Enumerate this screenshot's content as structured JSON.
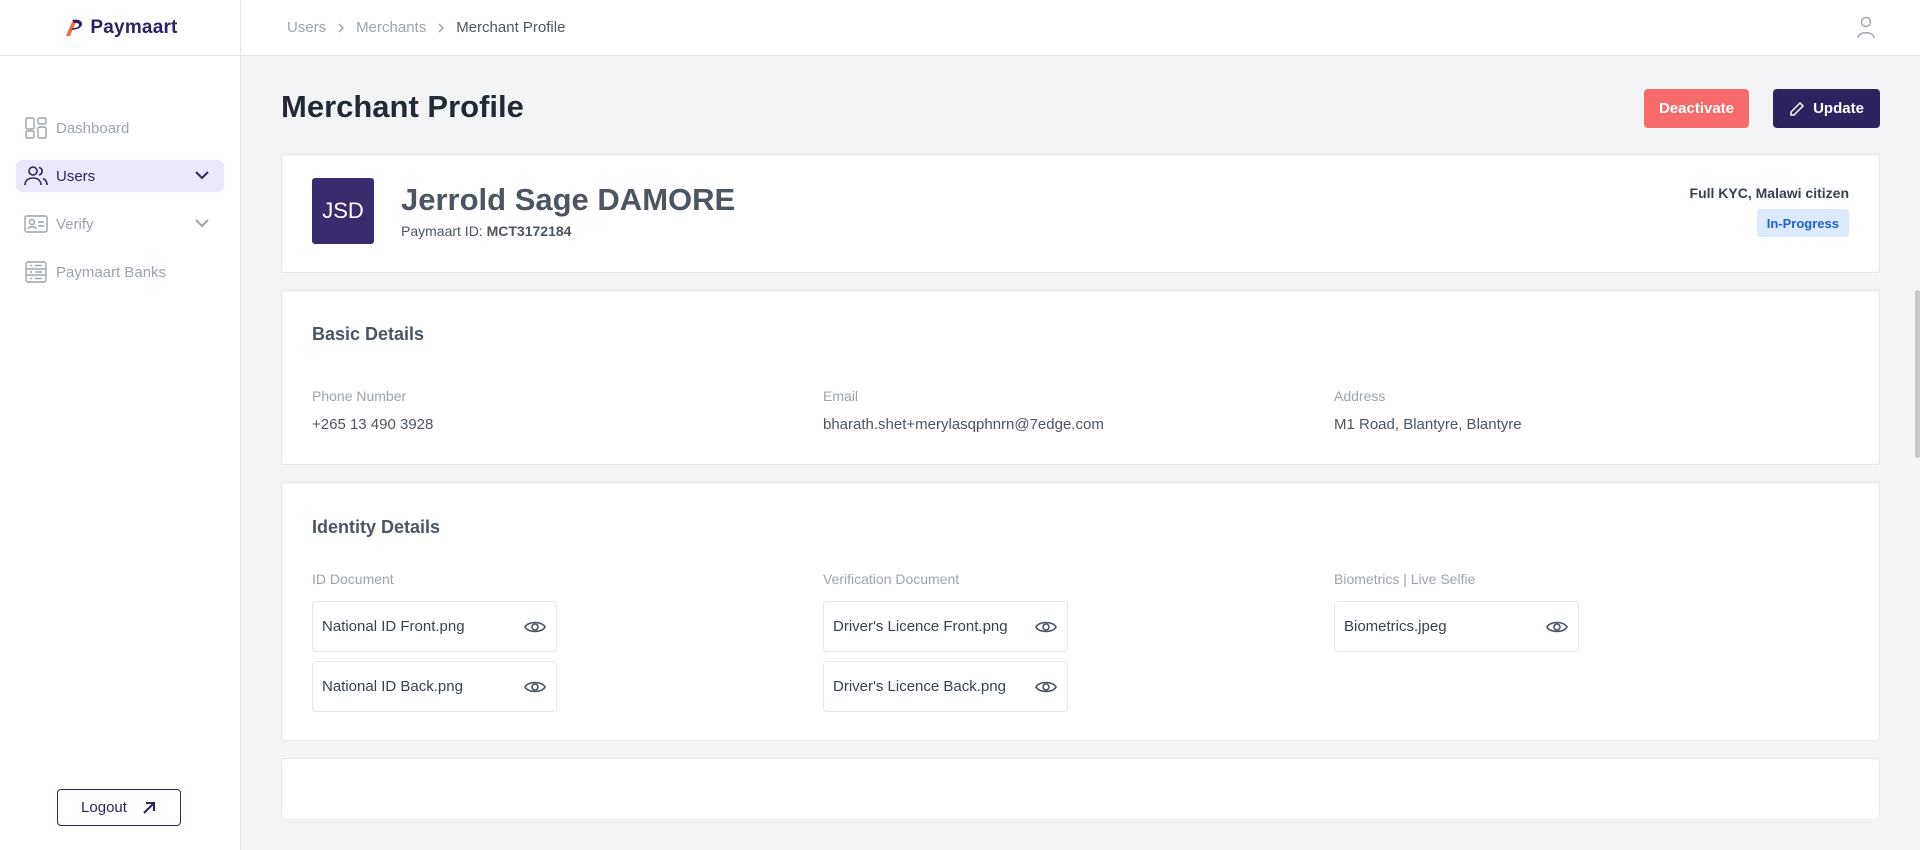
{
  "brand": {
    "name": "Paymaart"
  },
  "sidebar": {
    "items": [
      {
        "label": "Dashboard",
        "icon": "dashboard-icon"
      },
      {
        "label": "Users",
        "icon": "users-icon"
      },
      {
        "label": "Verify",
        "icon": "id-card-icon"
      },
      {
        "label": "Paymaart Banks",
        "icon": "bank-list-icon"
      }
    ],
    "logout_label": "Logout"
  },
  "header": {
    "breadcrumb": [
      "Users",
      "Merchants",
      "Merchant Profile"
    ]
  },
  "page": {
    "title": "Merchant Profile",
    "deactivate_label": "Deactivate",
    "update_label": "Update"
  },
  "profile": {
    "initials": "JSD",
    "name": "Jerrold Sage DAMORE",
    "id_label": "Paymaart ID:",
    "id_value": "MCT3172184",
    "kyc": "Full KYC, Malawi citizen",
    "status": "In-Progress"
  },
  "basic": {
    "title": "Basic Details",
    "phone_label": "Phone Number",
    "phone": "+265 13 490 3928",
    "email_label": "Email",
    "email": "bharath.shet+merylasqphnrn@7edge.com",
    "address_label": "Address",
    "address": "M1 Road, Blantyre, Blantyre"
  },
  "identity": {
    "title": "Identity Details",
    "id_doc_label": "ID Document",
    "id_docs": [
      "National ID Front.png",
      "National ID Back.png"
    ],
    "verification_label": "Verification Document",
    "verification_docs": [
      "Driver's Licence Front.png",
      "Driver's Licence Back.png"
    ],
    "biometrics_label": "Biometrics | Live Selfie",
    "biometrics_docs": [
      "Biometrics.jpeg"
    ]
  },
  "colors": {
    "brand": "#2e2361",
    "danger": "#f76b6b",
    "active_bg": "#ebe8fb",
    "status_bg": "#dbeafe",
    "status_text": "#1d63c6"
  }
}
